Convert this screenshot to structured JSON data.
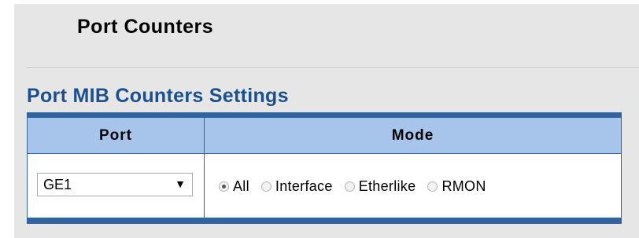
{
  "header": {
    "title": "Port Counters"
  },
  "section": {
    "title": "Port MIB Counters Settings"
  },
  "table": {
    "columns": [
      "Port",
      "Mode"
    ],
    "row": {
      "port_value": "GE1",
      "mode_options": [
        "All",
        "Interface",
        "Etherlike",
        "RMON"
      ],
      "selected_mode": "All"
    }
  },
  "icons": {
    "dropdown_arrow": "chevron-down-icon"
  },
  "colors": {
    "page_background": "#e6e6e6",
    "section_title": "#1c4f8c",
    "table_border": "#3063a2",
    "table_header": "#a7c4eb"
  }
}
